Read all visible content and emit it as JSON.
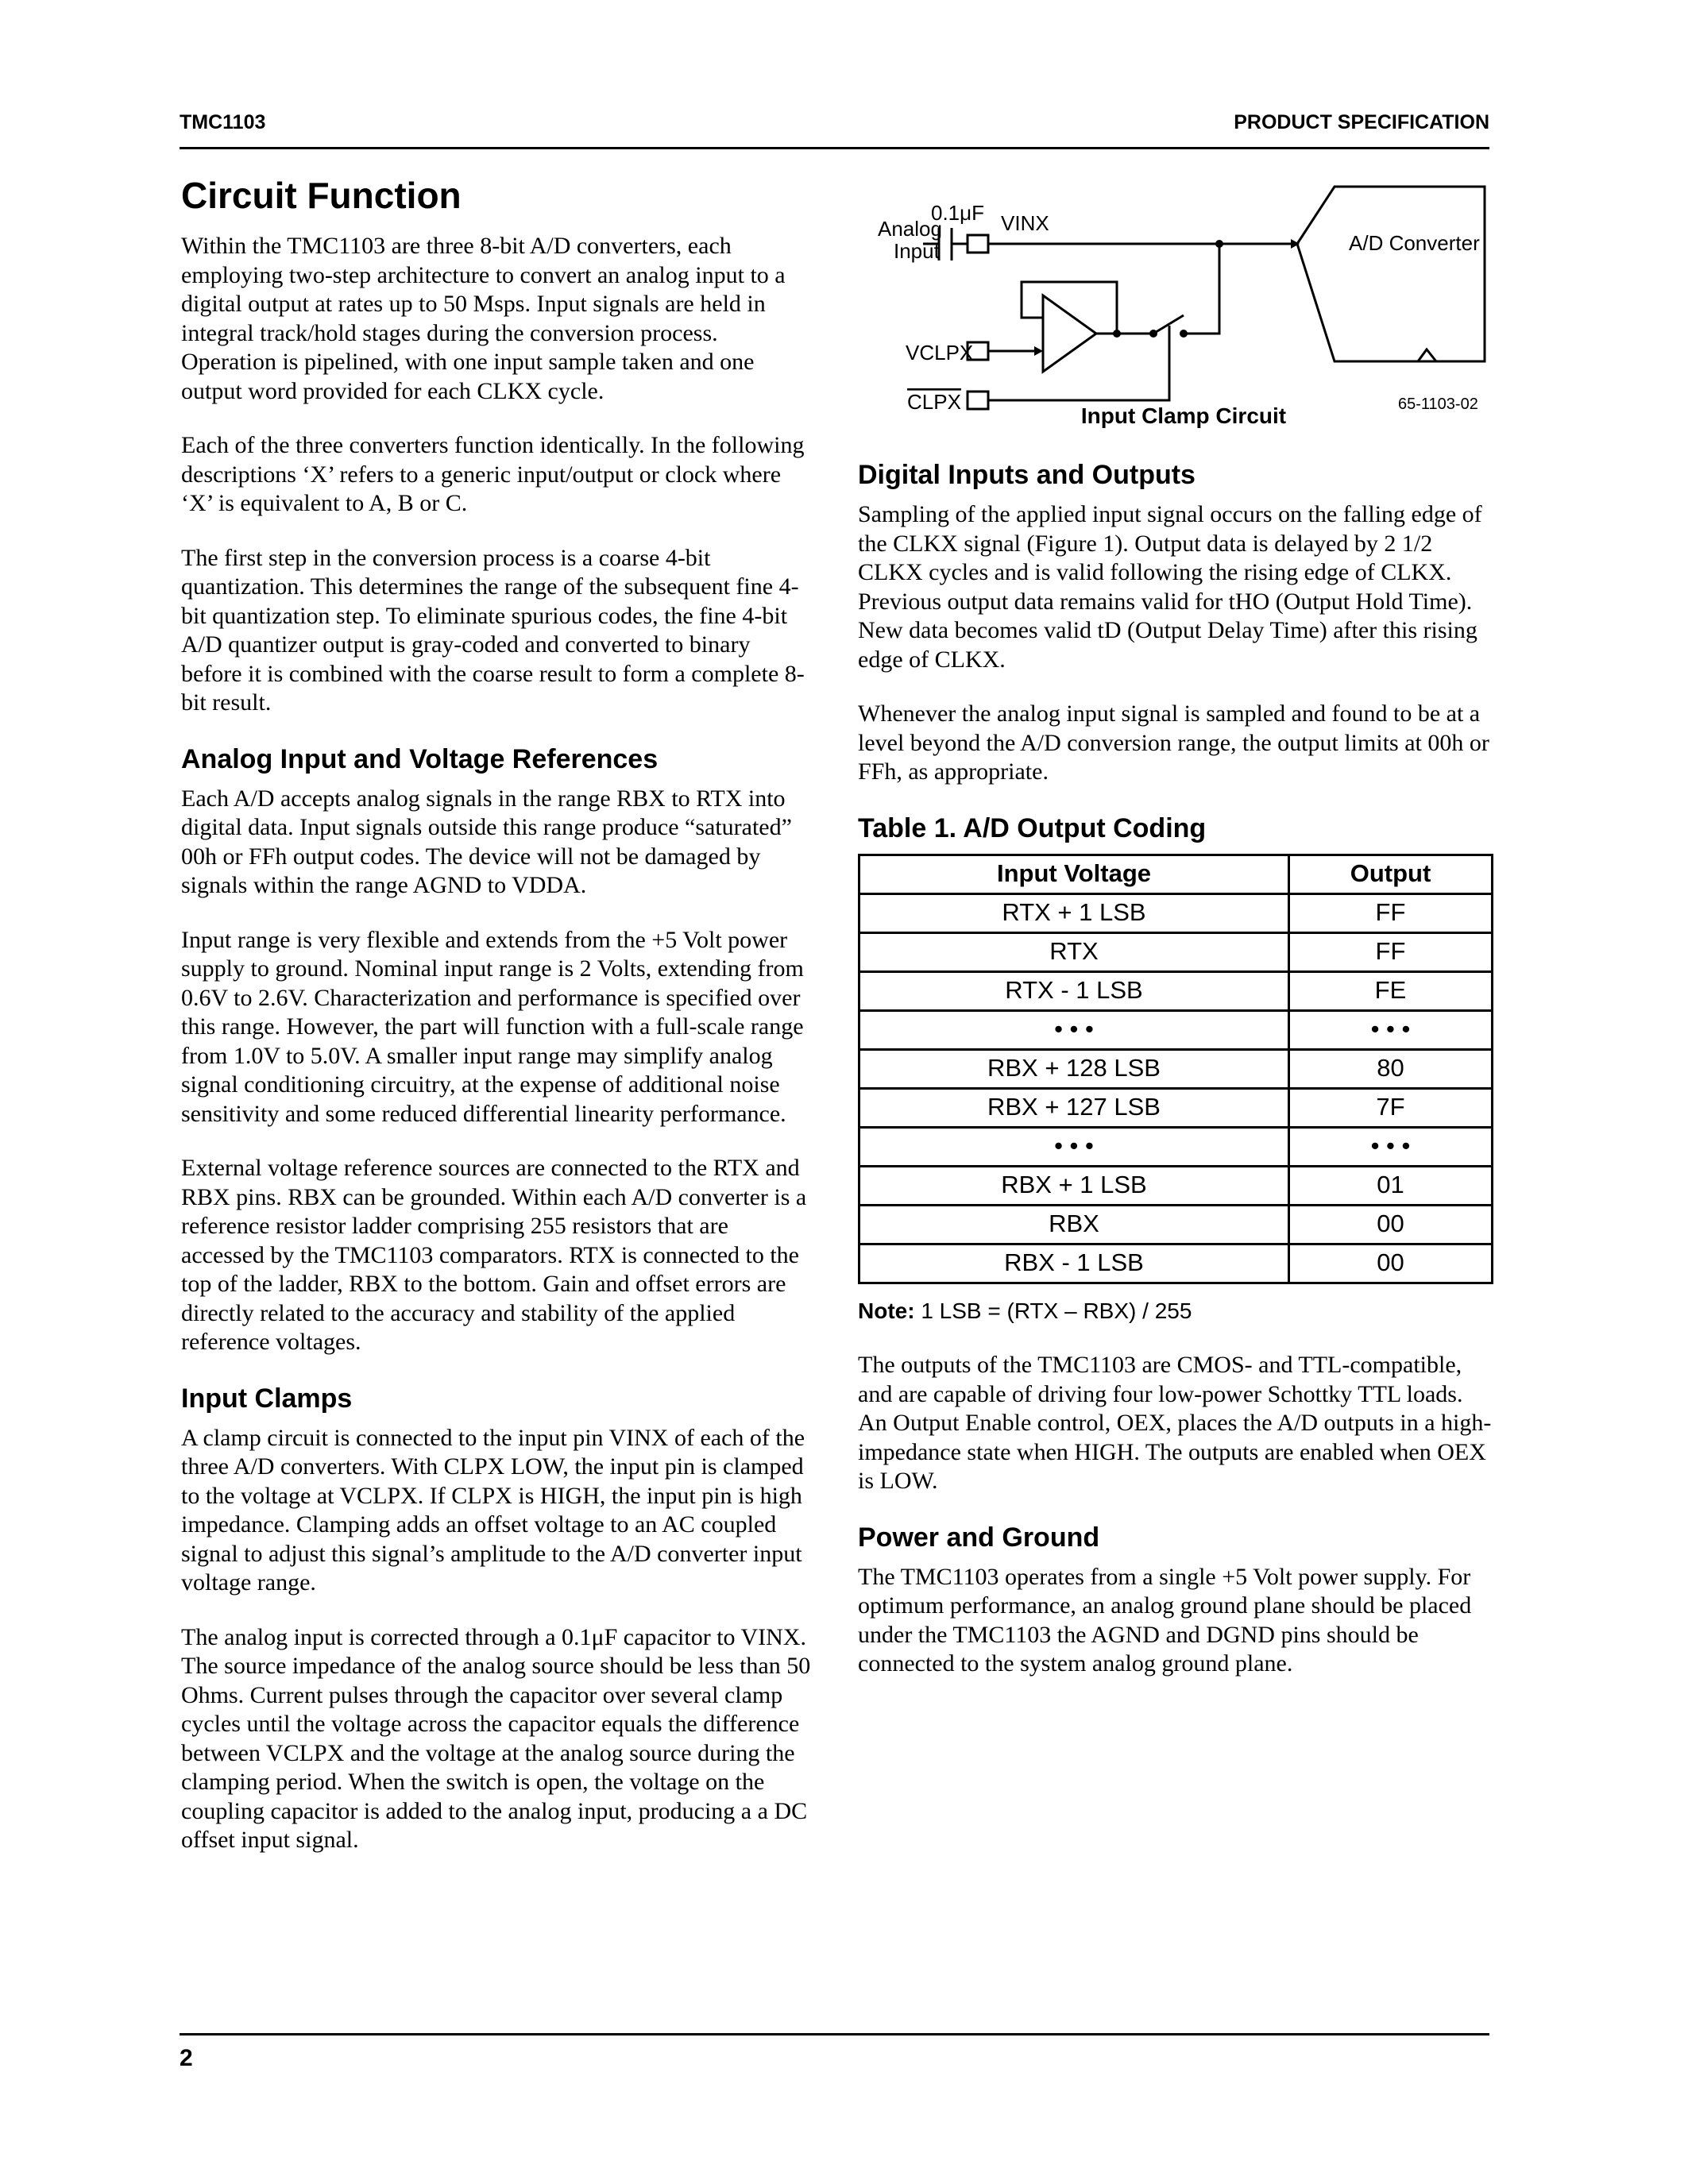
{
  "header": {
    "left": "TMC1103",
    "right": "PRODUCT SPECIFICATION"
  },
  "footer": {
    "page_number": "2"
  },
  "left_column": {
    "title": "Circuit Function",
    "p1": "Within the TMC1103 are three 8-bit A/D converters, each employing two-step architecture to convert an analog input to a digital output at rates up to 50 Msps. Input signals are held in integral track/hold stages during the conversion process. Operation is pipelined, with one input sample taken and one output word provided for each CLKX cycle.",
    "p2": "Each of the three converters function identically. In the following descriptions ‘X’ refers to a generic input/output or clock where ‘X’ is equivalent to A, B or C.",
    "p3": "The first step in the conversion process is a coarse 4-bit quantization. This determines the range of the subsequent fine 4-bit quantization step. To eliminate spurious codes, the fine 4-bit A/D quantizer output is gray-coded and converted to binary before it is combined with the coarse result to form a complete 8-bit result.",
    "analog_heading": "Analog Input and Voltage References",
    "a1": "Each A/D accepts analog signals in the range RBX to RTX into digital data. Input signals outside this range produce “saturated” 00h or FFh output codes. The device will not be damaged by signals within the range AGND to VDDA.",
    "a2": "Input range is very flexible and extends from the +5 Volt power supply to ground. Nominal input range is 2 Volts, extending from 0.6V to 2.6V. Characterization and performance is specified over this range. However, the part will function with a full-scale range from 1.0V to 5.0V. A smaller input range may simplify analog signal conditioning circuitry, at the expense of additional noise sensitivity and some reduced differential linearity performance.",
    "a3": "External voltage reference sources are connected to the RTX and RBX pins. RBX can be grounded. Within each A/D converter is a reference resistor ladder comprising 255 resistors that are accessed by the TMC1103 comparators. RTX is connected to the top of the ladder, RBX to the bottom. Gain and offset errors are directly related to the accuracy and stability of the applied reference voltages.",
    "clamps_heading": "Input Clamps",
    "c1": "A clamp circuit is connected to the input pin VINX of each of the three A/D converters. With CLPX LOW, the input pin is clamped to the voltage at VCLPX. If CLPX is HIGH, the input pin is high impedance. Clamping adds an offset voltage to an AC coupled signal to adjust this signal’s amplitude to the A/D converter input voltage range.",
    "c2": "The analog input is corrected through a 0.1μF capacitor to VINX. The source impedance of the analog source should be less than 50 Ohms. Current pulses through the capacitor over several clamp cycles until the voltage across the capacitor equals the difference between VCLPX and the voltage at the analog source during the clamping period. When the switch is open, the voltage on the coupling capacitor is added to the analog input, producing a a DC offset input signal."
  },
  "figure": {
    "analog": "Analog",
    "input": "Input",
    "cap": "0.1μF",
    "vinx": "VINX",
    "vclpx": "VCLPX",
    "clpx": "CLPX",
    "adc": "A/D Converter",
    "fig_id": "65-1103-02",
    "caption": "Input Clamp Circuit"
  },
  "right_column": {
    "digital_heading": "Digital Inputs and Outputs",
    "d1": "Sampling of the applied input signal occurs on the falling edge of the CLKX signal (Figure 1). Output data is delayed by 2 1/2 CLKX cycles and is valid following the rising edge of CLKX. Previous output data remains valid for tHO (Output Hold Time). New data becomes valid tD (Output Delay Time) after this rising edge of CLKX.",
    "d2": "Whenever the analog input signal is sampled and found to be at a level beyond the A/D conversion range, the output limits at 00h or FFh, as appropriate.",
    "table_title": "Table 1. A/D Output Coding",
    "table_headers": [
      "Input Voltage",
      "Output"
    ],
    "table_rows": [
      [
        "RTX + 1 LSB",
        "FF"
      ],
      [
        "RTX",
        "FF"
      ],
      [
        "RTX - 1 LSB",
        "FE"
      ],
      [
        "• • •",
        "• • •"
      ],
      [
        "RBX + 128 LSB",
        "80"
      ],
      [
        "RBX + 127 LSB",
        "7F"
      ],
      [
        "• • •",
        "• • •"
      ],
      [
        "RBX + 1 LSB",
        "01"
      ],
      [
        "RBX",
        "00"
      ],
      [
        "RBX - 1 LSB",
        "00"
      ]
    ],
    "note_label": "Note:",
    "note_text": "1 LSB = (RTX – RBX) / 255",
    "o1": "The outputs of the TMC1103 are CMOS- and TTL-compatible, and are capable of driving four low-power Schottky TTL loads. An Output Enable control, OEX, places the A/D outputs in a high-impedance state when HIGH. The outputs are enabled when OEX is LOW.",
    "power_heading": "Power and Ground",
    "pw1": "The TMC1103 operates from a single +5 Volt power supply. For optimum performance, an analog ground plane should be placed under the TMC1103 the AGND and DGND pins should be connected to the system analog ground plane."
  }
}
